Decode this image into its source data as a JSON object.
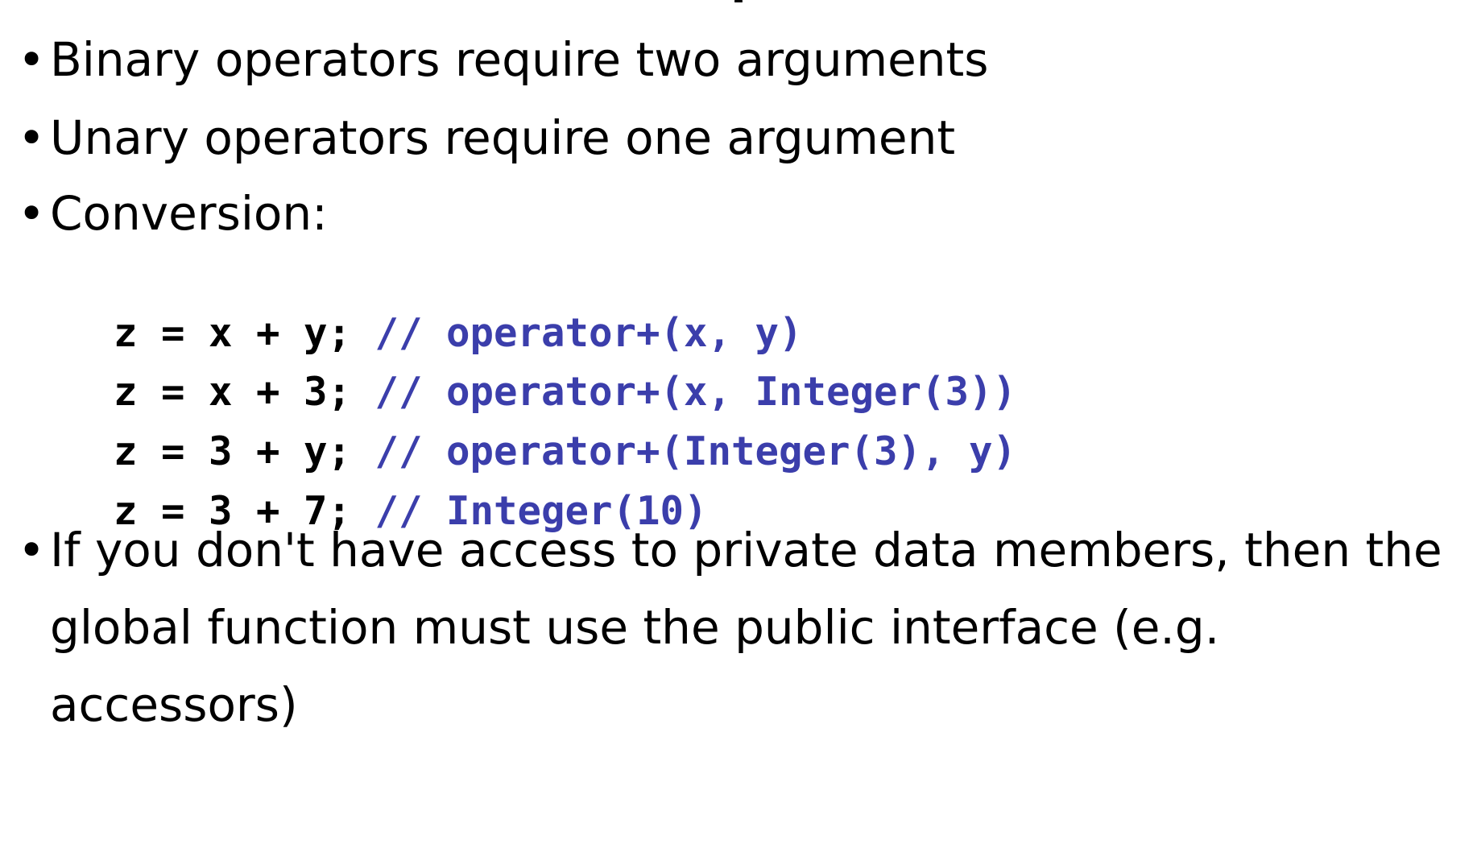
{
  "slide": {
    "title_fragment": "ı",
    "bullet_char": "•",
    "bullets": [
      "Binary operators require two arguments",
      "Unary operators require one argument",
      "Conversion:"
    ],
    "code": [
      {
        "stmt": "z = x + y;",
        "comment": "// operator+(x, y)"
      },
      {
        "stmt": "z = x + 3;",
        "comment": "// operator+(x, Integer(3))"
      },
      {
        "stmt": "z = 3 + y;",
        "comment": "// operator+(Integer(3), y)"
      },
      {
        "stmt": "z = 3 + 7;",
        "comment": "// Integer(10)"
      }
    ],
    "last_bullet": "If you don't have access to private data members, then the global function must use the public interface (e.g. accessors)"
  },
  "colors": {
    "text": "#000000",
    "comment": "#3b3eab",
    "background": "#ffffff"
  }
}
